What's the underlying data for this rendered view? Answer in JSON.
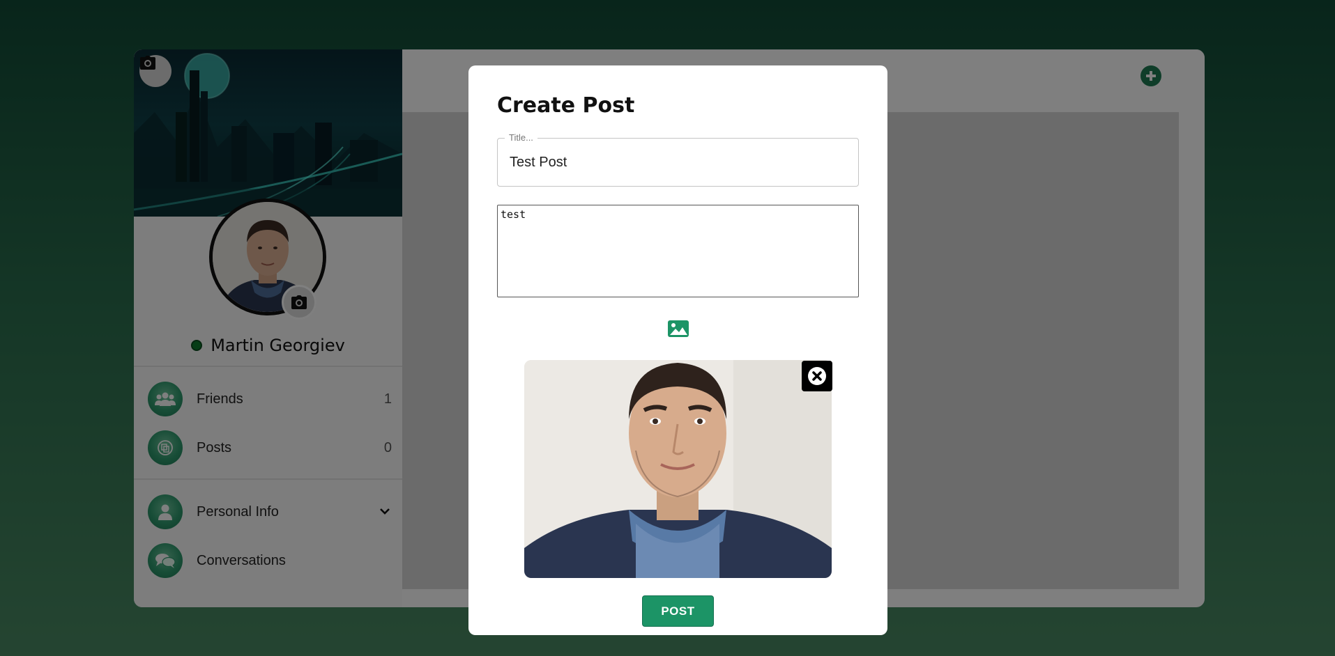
{
  "profile": {
    "name": "Martin Georgiev",
    "status": "online",
    "status_color": "#0d7a2c"
  },
  "sidebar": {
    "items": [
      {
        "label": "Friends",
        "count": "1",
        "icon": "friends-icon"
      },
      {
        "label": "Posts",
        "count": "0",
        "icon": "posts-icon"
      },
      {
        "label": "Personal Info",
        "icon": "user-icon",
        "expandable": true
      },
      {
        "label": "Conversations",
        "icon": "chat-icon"
      }
    ]
  },
  "modal": {
    "title": "Create Post",
    "title_field": {
      "label": "Title...",
      "value": "Test Post"
    },
    "body_field": {
      "value": "test"
    },
    "post_button": "POST"
  },
  "colors": {
    "accent": "#1c9466",
    "bg_dark": "#114a36",
    "bg_light": "#4a8a63"
  }
}
